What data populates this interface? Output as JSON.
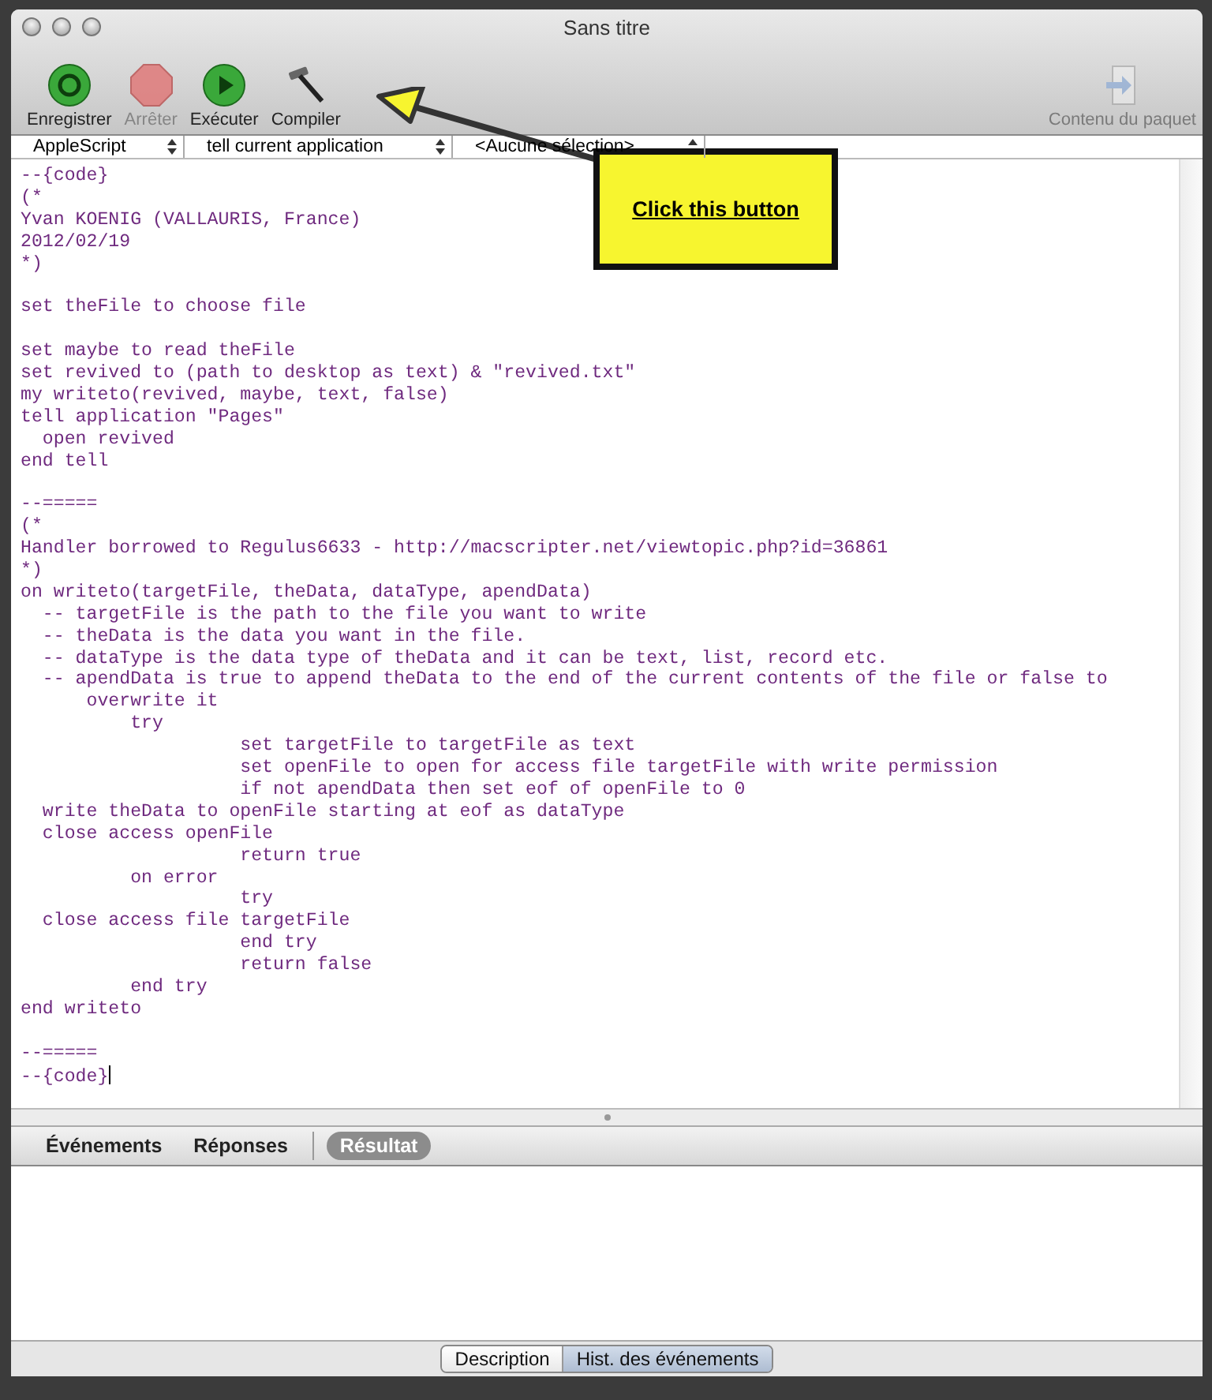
{
  "window": {
    "title": "Sans titre"
  },
  "toolbar": {
    "items": [
      {
        "kind": "record",
        "label": "Enregistrer",
        "disabled": false
      },
      {
        "kind": "stop",
        "label": "Arrêter",
        "disabled": true
      },
      {
        "kind": "run",
        "label": "Exécuter",
        "disabled": false
      },
      {
        "kind": "compile",
        "label": "Compiler",
        "disabled": false
      }
    ],
    "bundle": {
      "label": "Contenu du paquet",
      "disabled": true
    }
  },
  "navigation_bar": [
    "AppleScript",
    "tell current application",
    "<Aucune sélection>"
  ],
  "editor": {
    "code_blocks": [
      [
        "--{code}",
        "(*",
        "Yvan KOENIG (VALLAURIS, France)",
        "2012/02/19",
        "*)"
      ],
      [
        "set theFile to choose file"
      ],
      [
        "set maybe to read theFile",
        "set revived to (path to desktop as text) & \"revived.txt\"",
        "my writeto(revived, maybe, text, false)",
        "tell application \"Pages\"",
        "  open revived",
        "end tell"
      ],
      [
        "--=====",
        "(*",
        "Handler borrowed to Regulus6633 - http://macscripter.net/viewtopic.php?id=36861",
        "*)",
        "on writeto(targetFile, theData, dataType, apendData)",
        "  -- targetFile is the path to the file you want to write",
        "  -- theData is the data you want in the file.",
        "  -- dataType is the data type of theData and it can be text, list, record etc.",
        "  -- apendData is true to append theData to the end of the current contents of the file or false to",
        "      overwrite it",
        "          try",
        "                    set targetFile to targetFile as text",
        "                    set openFile to open for access file targetFile with write permission",
        "                    if not apendData then set eof of openFile to 0",
        "  write theData to openFile starting at eof as dataType",
        "  close access openFile",
        "                    return true",
        "          on error",
        "                    try",
        "  close access file targetFile",
        "                    end try",
        "                    return false",
        "          end try",
        "end writeto"
      ],
      [
        "--=====",
        "--{code}"
      ]
    ]
  },
  "result_tabs": [
    {
      "label": "Événements",
      "selected": false
    },
    {
      "label": "Réponses",
      "selected": false
    },
    {
      "label": "Résultat",
      "selected": true
    }
  ],
  "bottom_tabs": [
    {
      "label": "Description",
      "selected": false
    },
    {
      "label": "Hist. des événements",
      "selected": true
    }
  ],
  "annotation": {
    "text": "Click this button"
  }
}
